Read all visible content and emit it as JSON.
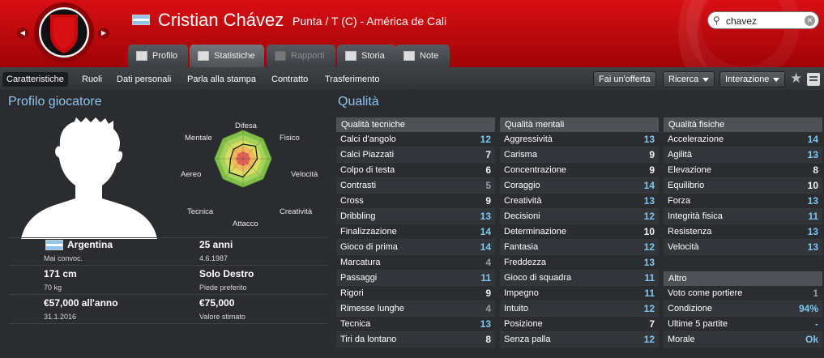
{
  "header": {
    "player_name": "Cristian Chávez",
    "player_info": "Punta / T (C) - América de Cali",
    "search_value": "chavez",
    "nationality_flag": "argentina-flag"
  },
  "tabs": [
    {
      "label": "Profilo",
      "icon": "profile-card-icon"
    },
    {
      "label": "Statistiche",
      "icon": "stats-bars-icon"
    },
    {
      "label": "Rapporti",
      "icon": "reports-notebook-icon"
    },
    {
      "label": "Storia",
      "icon": "history-book-icon"
    },
    {
      "label": "Note",
      "icon": "note-icon"
    }
  ],
  "subnav": [
    "Caratteristiche",
    "Ruoli",
    "Dati personali",
    "Parla alla stampa",
    "Contratto",
    "Trasferimento"
  ],
  "buttons": {
    "offer": "Fai un'offerta",
    "search": "Ricerca",
    "interact": "Interazione"
  },
  "profile": {
    "title": "Profilo giocatore",
    "nationality": "Argentina",
    "caps": "Mai convoc.",
    "age": "25 anni",
    "dob": "4.6.1987",
    "height": "171 cm",
    "weight": "70 kg",
    "foot": "Solo Destro",
    "foot_label": "Piede preferito",
    "wage": "€57,000 all'anno",
    "contract_end": "31.1.2016",
    "value": "€75,000",
    "value_label": "Valore stimato"
  },
  "radar": {
    "axes": [
      "Difesa",
      "Fisico",
      "Velocità",
      "Creatività",
      "Attacco",
      "Tecnica",
      "Aereo",
      "Mentale"
    ]
  },
  "quality": {
    "title": "Qualità",
    "technical": {
      "header": "Qualità tecniche",
      "rows": [
        {
          "label": "Calci d'angolo",
          "value": "12"
        },
        {
          "label": "Calci Piazzati",
          "value": "7"
        },
        {
          "label": "Colpo di testa",
          "value": "6"
        },
        {
          "label": "Contrasti",
          "value": "5"
        },
        {
          "label": "Cross",
          "value": "9"
        },
        {
          "label": "Dribbling",
          "value": "13"
        },
        {
          "label": "Finalizzazione",
          "value": "14"
        },
        {
          "label": "Gioco di prima",
          "value": "14"
        },
        {
          "label": "Marcatura",
          "value": "4"
        },
        {
          "label": "Passaggi",
          "value": "11"
        },
        {
          "label": "Rigori",
          "value": "9"
        },
        {
          "label": "Rimesse lunghe",
          "value": "4"
        },
        {
          "label": "Tecnica",
          "value": "13"
        },
        {
          "label": "Tiri da lontano",
          "value": "8"
        }
      ]
    },
    "mental": {
      "header": "Qualità mentali",
      "rows": [
        {
          "label": "Aggressività",
          "value": "13"
        },
        {
          "label": "Carisma",
          "value": "9"
        },
        {
          "label": "Concentrazione",
          "value": "9"
        },
        {
          "label": "Coraggio",
          "value": "14"
        },
        {
          "label": "Creatività",
          "value": "13"
        },
        {
          "label": "Decisioni",
          "value": "12"
        },
        {
          "label": "Determinazione",
          "value": "10"
        },
        {
          "label": "Fantasia",
          "value": "12"
        },
        {
          "label": "Freddezza",
          "value": "13"
        },
        {
          "label": "Gioco di squadra",
          "value": "11"
        },
        {
          "label": "Impegno",
          "value": "11"
        },
        {
          "label": "Intuito",
          "value": "12"
        },
        {
          "label": "Posizione",
          "value": "7"
        },
        {
          "label": "Senza palla",
          "value": "12"
        }
      ]
    },
    "physical": {
      "header": "Qualità fisiche",
      "rows": [
        {
          "label": "Accelerazione",
          "value": "14"
        },
        {
          "label": "Agilità",
          "value": "13"
        },
        {
          "label": "Elevazione",
          "value": "8"
        },
        {
          "label": "Equilibrio",
          "value": "10"
        },
        {
          "label": "Forza",
          "value": "13"
        },
        {
          "label": "Integrità fisica",
          "value": "11"
        },
        {
          "label": "Resistenza",
          "value": "13"
        },
        {
          "label": "Velocità",
          "value": "13"
        }
      ]
    },
    "other": {
      "header": "Altro",
      "rows": [
        {
          "label": "Voto come portiere",
          "value": "1"
        },
        {
          "label": "Condizione",
          "value": "94%"
        },
        {
          "label": "Ultime 5 partite",
          "value": "-"
        },
        {
          "label": "Morale",
          "value": "Ok"
        }
      ]
    }
  },
  "colors": {
    "header_red": "#c8080c",
    "section_title": "#8ec4ee",
    "value_high": "#7fc6f0",
    "value_mid": "#f2f2f2",
    "value_low": "#9a9a9a"
  }
}
